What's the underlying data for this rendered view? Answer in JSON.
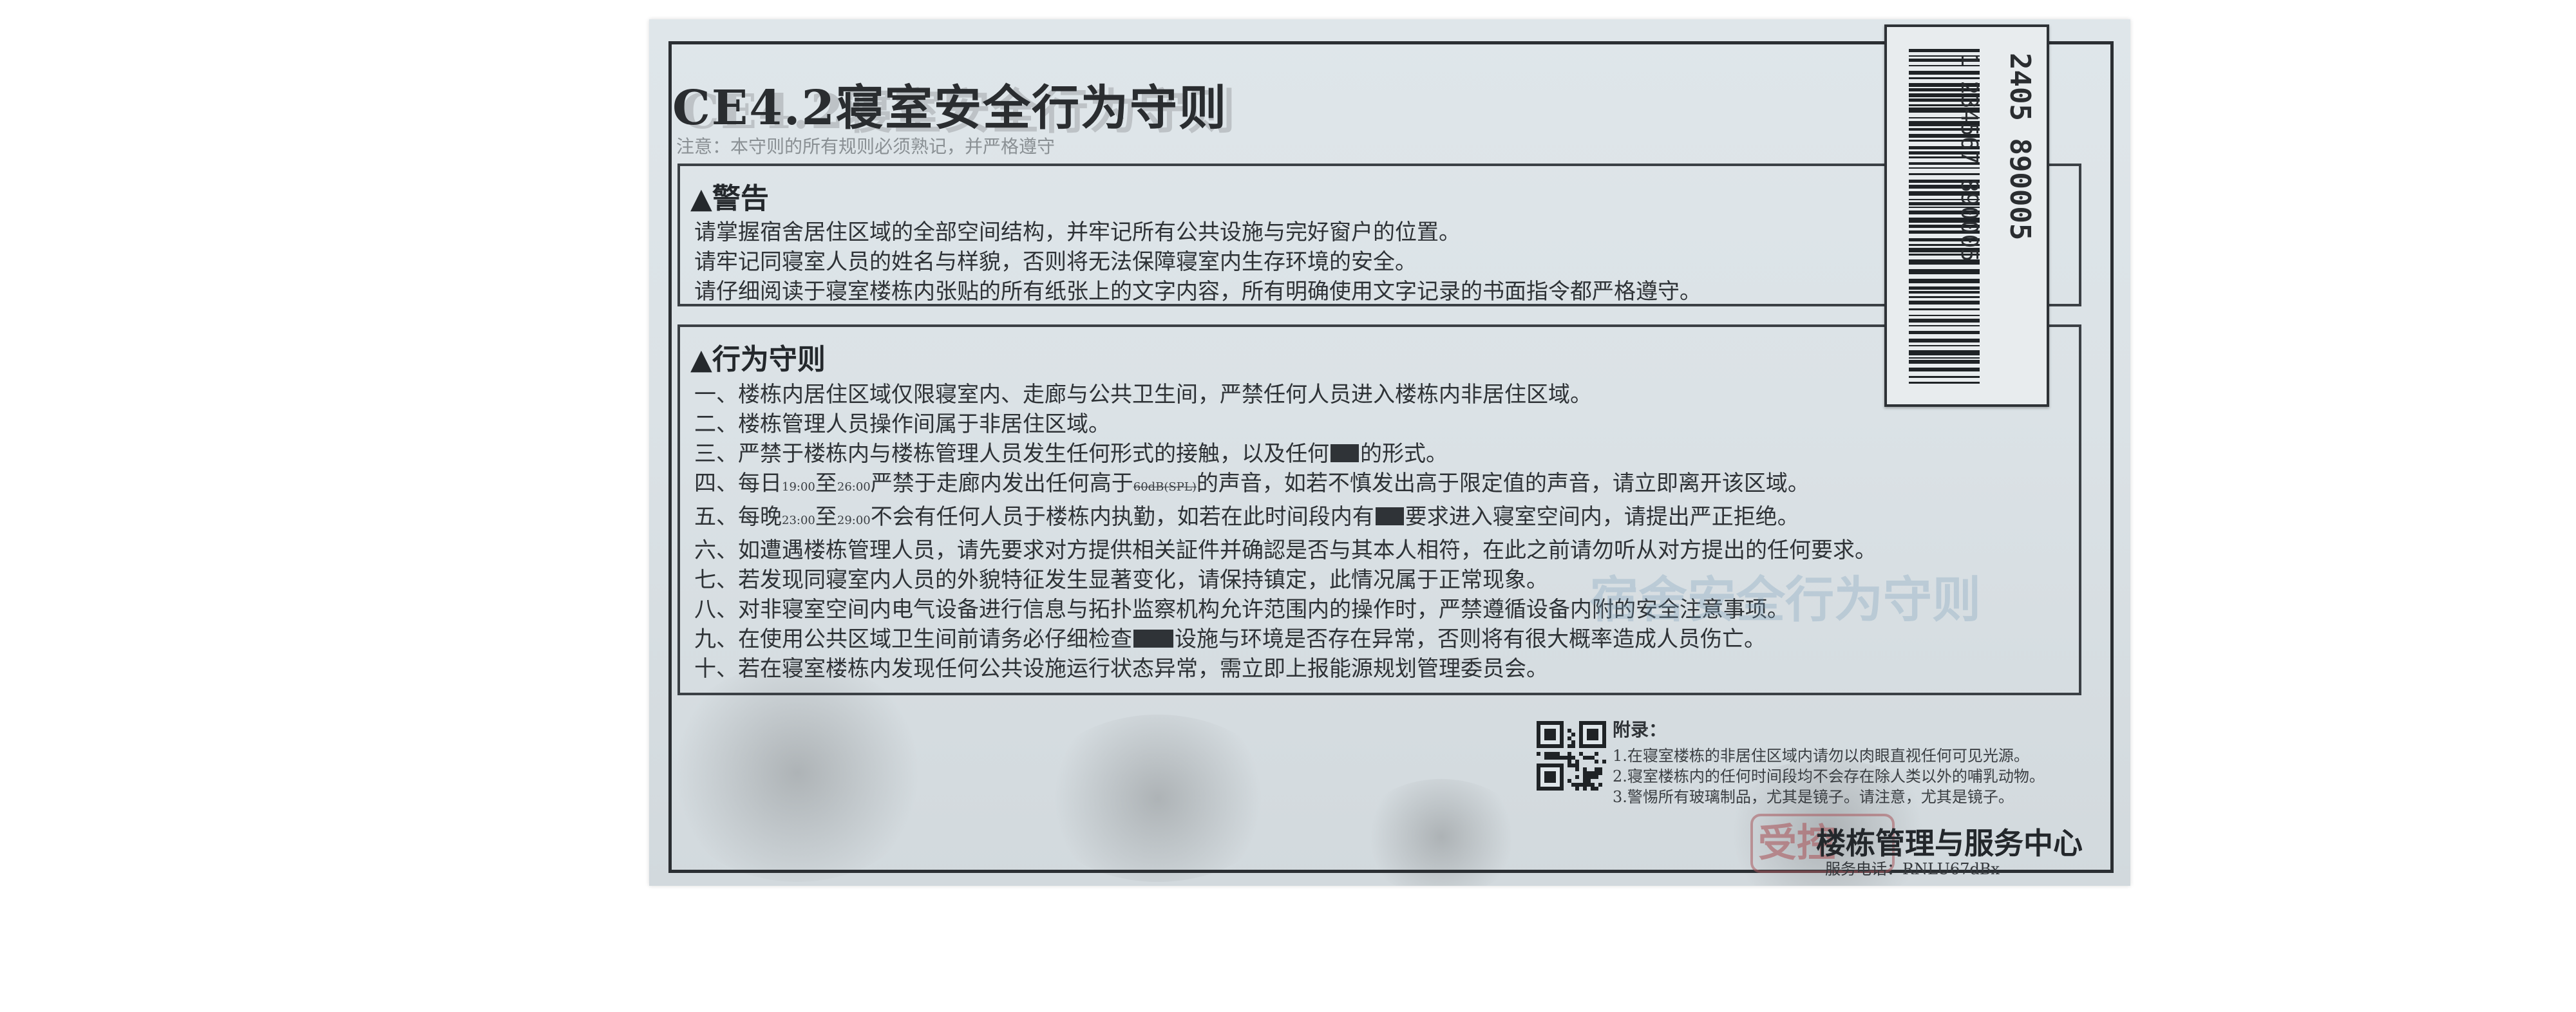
{
  "document": {
    "title": "CE4.2寝室安全行为守则",
    "note": "注意：本守则的所有规则必须熟记，并严格遵守",
    "warning": {
      "heading": "▲警告",
      "lines": [
        "请掌握宿舍居住区域的全部空间结构，并牢记所有公共设施与完好窗户的位置。",
        "请牢记同寝室人员的姓名与样貌，否则将无法保障寝室内生存环境的安全。",
        "请仔细阅读于寝室楼栋内张贴的所有纸张上的文字内容，所有明确使用文字记录的书面指令都严格遵守。"
      ]
    },
    "rules": {
      "heading": "▲行为守则",
      "r1": "一、楼栋内居住区域仅限寝室内、走廊与公共卫生间，严禁任何人员进入楼栋内非居住区域。",
      "r2": "二、楼栋管理人员操作间属于非居住区域。",
      "r3_a": "三、严禁于楼栋内与楼栋管理人员发生任何形式的接触，以及任何",
      "r3_b": "的形式。",
      "r4_a": "四、每日",
      "r4_t1": "19:00",
      "r4_mid1": "至",
      "r4_t2": "26:00",
      "r4_b": "严禁于走廊内发出任何高于",
      "r4_db": "60dB(SPL)",
      "r4_c": "的声音，如若不慎发出高于限定值的声音，请立即离开该区域。",
      "r5_a": "五、每晚",
      "r5_t1": "23:00",
      "r5_mid": "至",
      "r5_t2": "29:00",
      "r5_b": "不会有任何人员于楼栋内执勤，如若在此时间段内有",
      "r5_c": "要求进入寝室空间内，请提出严正拒绝。",
      "r6": "六、如遭遇楼栋管理人员，请先要求对方提供相关証件并确認是否与其本人相符，在此之前请勿听从对方提出的任何要求。",
      "r7": "七、若发现同寝室内人员的外貌特征发生显著变化，请保持镇定，此情况属于正常现象。",
      "r8": "八、对非寝室空间内电气设备进行信息与拓扑监察机构允许范围内的操作时，严禁遵循设备内附的安全注意事项。",
      "r9_a": "九、在使用公共区域卫生间前请务必仔细检查",
      "r9_b": "设施与环境是否存在异常，否则将有很大概率造成人员伤亡。",
      "r10": "十、若在寝室楼栋内发现任何公共设施运行状态异常，需立即上报能源规划管理委员会。"
    },
    "ghost_text": "宿舍安全行为守则",
    "label": {
      "mark": "I",
      "left_digits": "1 234567 890005",
      "right_digits": "2405 890005",
      "barcode_top_digits": "11"
    },
    "appendix": {
      "title": "附录：",
      "items": [
        "1.在寝室楼栋的非居住区域内请勿以肉眼直视任何可见光源。",
        "2.寝室楼栋内的任何时间段均不会存在除人类以外的哺乳动物。",
        "3.警惕所有玻璃制品，尤其是镜子。请注意，尤其是镜子。"
      ]
    },
    "footer": {
      "stamp": "受控",
      "org": "楼栋管理与服务中心",
      "contact": "服务电话：RNLU67dBx"
    }
  },
  "colors": {
    "paper": "#dfe6ea",
    "ink": "#2e3236",
    "stamp": "#aa5a5f",
    "ghost": "#6e96b4"
  }
}
